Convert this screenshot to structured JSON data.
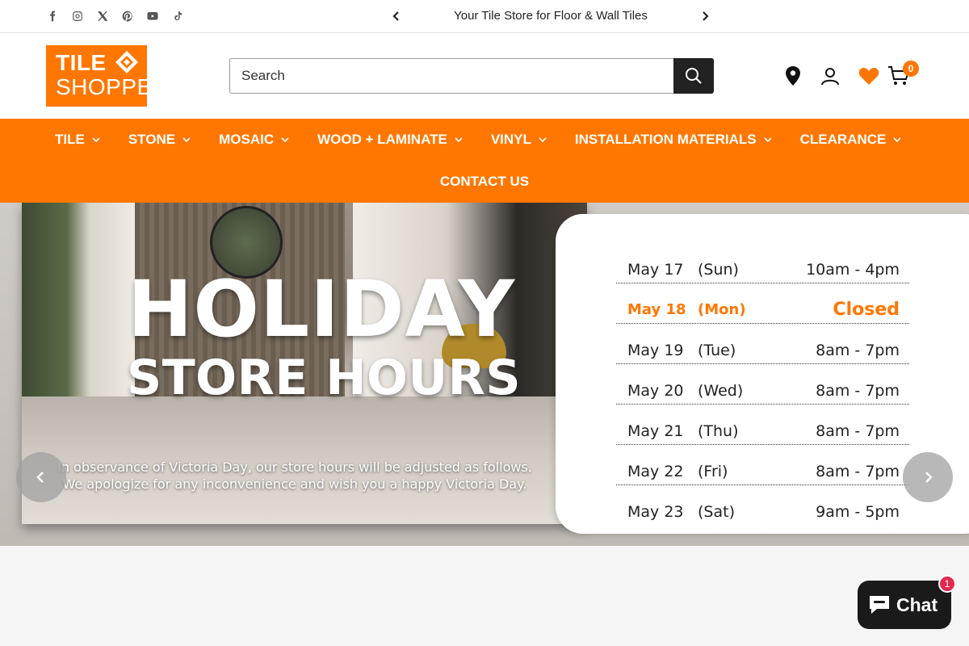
{
  "topbar": {
    "socials": [
      "facebook-icon",
      "instagram-icon",
      "x-icon",
      "pinterest-icon",
      "youtube-icon",
      "tiktok-icon"
    ],
    "promo": "Your Tile Store for Floor & Wall Tiles"
  },
  "header": {
    "logo_line1": "TILE",
    "logo_line2": "SHOPPE",
    "search_placeholder": "Search",
    "cart_count": "0"
  },
  "nav": {
    "items": [
      {
        "label": "TILE"
      },
      {
        "label": "STONE"
      },
      {
        "label": "MOSAIC"
      },
      {
        "label": "WOOD + LAMINATE"
      },
      {
        "label": "VINYL"
      },
      {
        "label": "INSTALLATION MATERIALS"
      },
      {
        "label": "CLEARANCE"
      }
    ],
    "contact": "CONTACT US"
  },
  "hero": {
    "title": "HOLIDAY",
    "subtitle": "STORE HOURS",
    "note_line1": "In observance of Victoria Day, our store hours will be adjusted as follows.",
    "note_line2": "We apologize for any inconvenience and wish you a happy Victoria Day.",
    "hours": [
      {
        "date": "May 17",
        "day": "(Sun)",
        "hours": "10am - 4pm"
      },
      {
        "date": "May 18",
        "day": "(Mon)",
        "hours": "Closed"
      },
      {
        "date": "May 19",
        "day": "(Tue)",
        "hours": "8am - 7pm"
      },
      {
        "date": "May 20",
        "day": "(Wed)",
        "hours": "8am - 7pm"
      },
      {
        "date": "May 21",
        "day": "(Thu)",
        "hours": "8am - 7pm"
      },
      {
        "date": "May 22",
        "day": "(Fri)",
        "hours": "8am - 7pm"
      },
      {
        "date": "May 23",
        "day": "(Sat)",
        "hours": "9am - 5pm"
      }
    ]
  },
  "chat": {
    "label": "Chat",
    "badge": "1"
  },
  "colors": {
    "brand": "#ff7700",
    "dark": "#222222",
    "chat_badge": "#e2294f"
  }
}
